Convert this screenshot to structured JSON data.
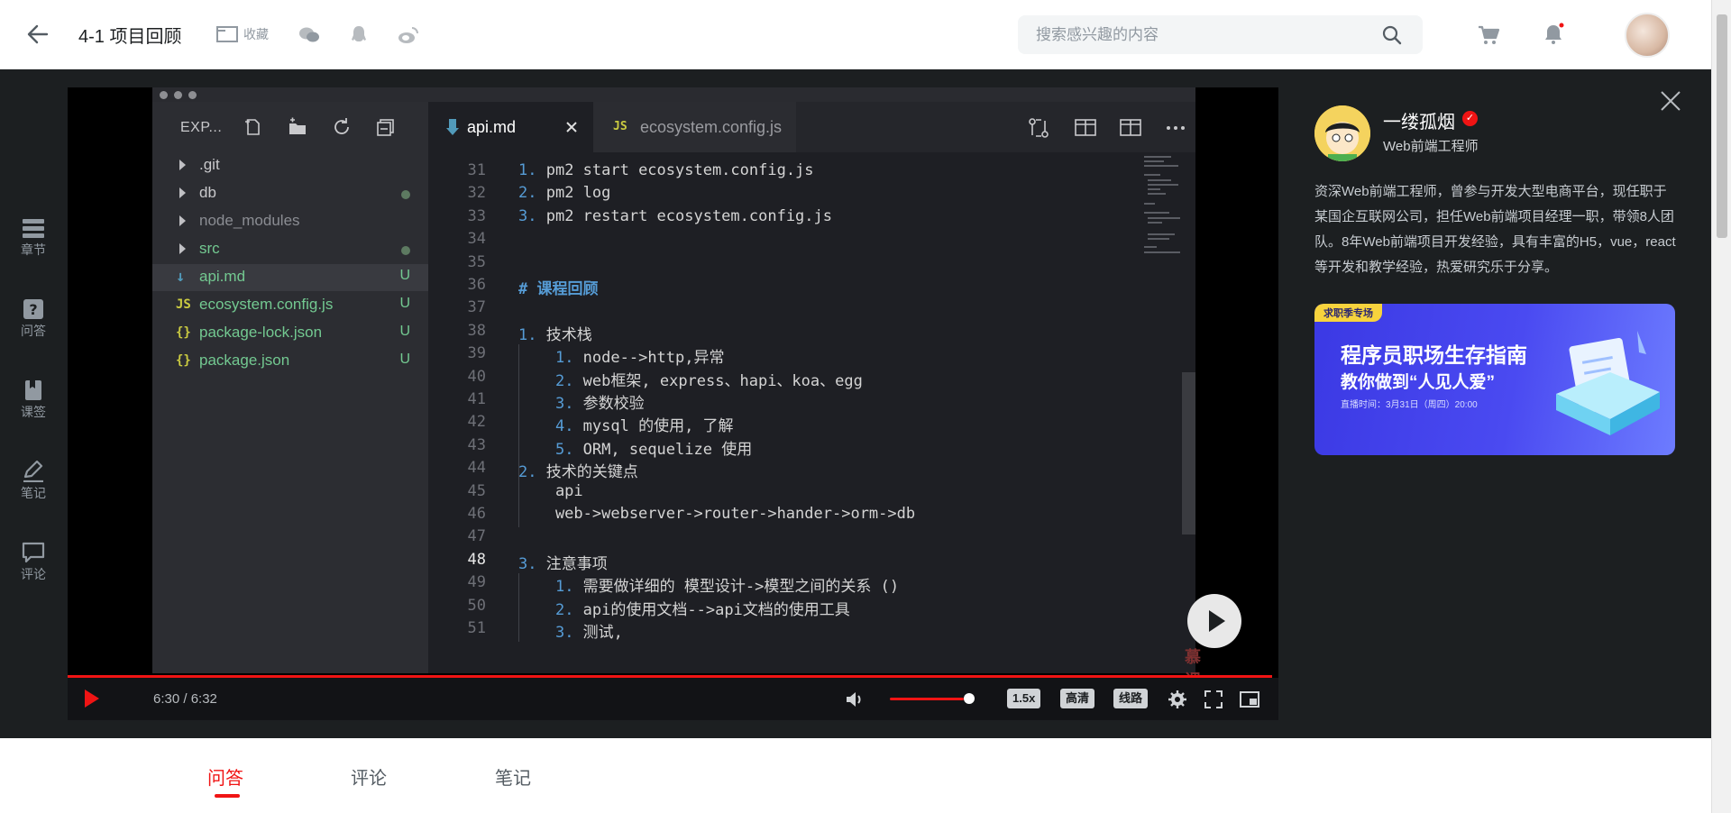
{
  "header": {
    "title": "4-1 项目回顾",
    "collect_label": "收藏",
    "search_placeholder": "搜索感兴趣的内容"
  },
  "leftnav": {
    "items": [
      {
        "label": "章节",
        "icon": "chapters-icon"
      },
      {
        "label": "问答",
        "icon": "question-icon"
      },
      {
        "label": "课签",
        "icon": "bookmark-icon"
      },
      {
        "label": "笔记",
        "icon": "pencil-icon"
      },
      {
        "label": "评论",
        "icon": "comment-icon"
      }
    ]
  },
  "ide": {
    "explorer_title": "EXP...",
    "files": [
      {
        "name": ".git",
        "type": "folder",
        "color": "#c9c9cc",
        "status": ""
      },
      {
        "name": "db",
        "type": "folder",
        "color": "#c9c9cc",
        "status": "dot"
      },
      {
        "name": "node_modules",
        "type": "folder",
        "color": "#8b8d93",
        "status": ""
      },
      {
        "name": "src",
        "type": "folder",
        "color": "#73c991",
        "status": "dot"
      },
      {
        "name": "api.md",
        "type": "md",
        "color": "#73c991",
        "status": "U"
      },
      {
        "name": "ecosystem.config.js",
        "type": "js",
        "color": "#73c991",
        "status": "U"
      },
      {
        "name": "package-lock.json",
        "type": "json",
        "color": "#73c991",
        "status": "U"
      },
      {
        "name": "package.json",
        "type": "json",
        "color": "#73c991",
        "status": "U"
      }
    ],
    "tabs": [
      {
        "label": "api.md",
        "active": true
      },
      {
        "label": "ecosystem.config.js",
        "active": false
      }
    ],
    "code_lines": [
      {
        "n": "31",
        "text": "1. pm2 start ecosystem.config.js"
      },
      {
        "n": "32",
        "text": "2. pm2 log"
      },
      {
        "n": "33",
        "text": "3. pm2 restart ecosystem.config.js"
      },
      {
        "n": "34",
        "text": ""
      },
      {
        "n": "35",
        "text": ""
      },
      {
        "n": "36",
        "text": "# 课程回顾"
      },
      {
        "n": "37",
        "text": ""
      },
      {
        "n": "38",
        "text": "1. 技术栈"
      },
      {
        "n": "39",
        "text": "    1. node-->http,异常"
      },
      {
        "n": "40",
        "text": "    2. web框架, express、hapi、koa、egg"
      },
      {
        "n": "41",
        "text": "    3. 参数校验"
      },
      {
        "n": "42",
        "text": "    4. mysql 的使用, 了解"
      },
      {
        "n": "43",
        "text": "    5. ORM, sequelize 使用"
      },
      {
        "n": "44",
        "text": "2. 技术的关键点"
      },
      {
        "n": "45",
        "text": "    api"
      },
      {
        "n": "46",
        "text": "    web->webserver->router->hander->orm->db"
      },
      {
        "n": "47",
        "text": ""
      },
      {
        "n": "48",
        "text": "3. 注意事项"
      },
      {
        "n": "49",
        "text": "    1. 需要做详细的 模型设计->模型之间的关系 ()"
      },
      {
        "n": "50",
        "text": "    2. api的使用文档-->api文档的使用工具"
      },
      {
        "n": "51",
        "text": "    3. 测试,"
      }
    ],
    "watermark": "慕课网"
  },
  "player": {
    "time": "6:30 / 6:32",
    "progress": 0.995,
    "volume": 0.85,
    "speed_label": "1.5x",
    "quality_label": "高清",
    "line_label": "线路"
  },
  "teacher": {
    "name": "一缕孤烟",
    "title": "Web前端工程师",
    "description": "资深Web前端工程师，曾参与开发大型电商平台，现任职于某国企互联网公司，担任Web前端项目经理一职，带领8人团队。8年Web前端项目开发经验，具有丰富的H5，vue，react等开发和教学经验，热爱研究乐于分享。"
  },
  "banner": {
    "tag": "求职季专场",
    "line1": "程序员职场生存指南",
    "line2": "教你做到“人见人爱”",
    "line3": "直播时间：3月31日（周四）20:00"
  },
  "bottom_tabs": [
    {
      "label": "问答",
      "active": true
    },
    {
      "label": "评论",
      "active": false
    },
    {
      "label": "笔记",
      "active": false
    }
  ],
  "colors": {
    "accent": "#f01414",
    "dark_bg": "#1c1f21",
    "git_untracked": "#73c991"
  }
}
